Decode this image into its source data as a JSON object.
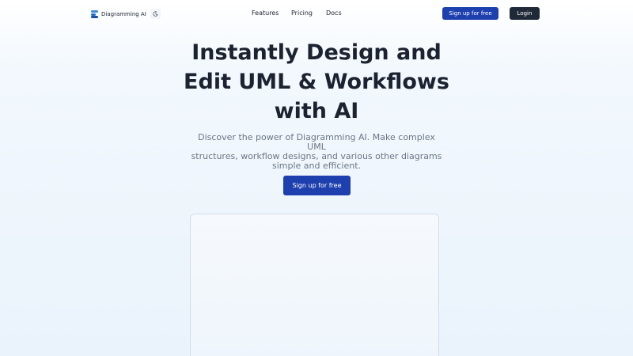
{
  "brand": {
    "name": "Diagramming AI",
    "logo_icon": "stacked-bars-logo-icon",
    "colors": [
      "#3b8be0",
      "#1e6fcf",
      "#1a4fa8"
    ]
  },
  "nav": {
    "theme_toggle_icon": "moon-icon",
    "links": [
      {
        "label": "Features"
      },
      {
        "label": "Pricing"
      },
      {
        "label": "Docs"
      }
    ],
    "signup_label": "Sign up for free",
    "login_label": "Login"
  },
  "hero": {
    "title_lines": [
      "Instantly Design and",
      "Edit UML & Workflows",
      "with AI"
    ],
    "subtitle_lines": [
      "Discover the power of Diagramming AI. Make complex UML",
      "structures, workflow designs, and various other diagrams",
      "simple and efficient."
    ],
    "cta_label": "Sign up for free"
  },
  "colors": {
    "primary": "#1e40af",
    "dark": "#1f2937",
    "text": "#1c2230",
    "muted": "#6b7685"
  }
}
